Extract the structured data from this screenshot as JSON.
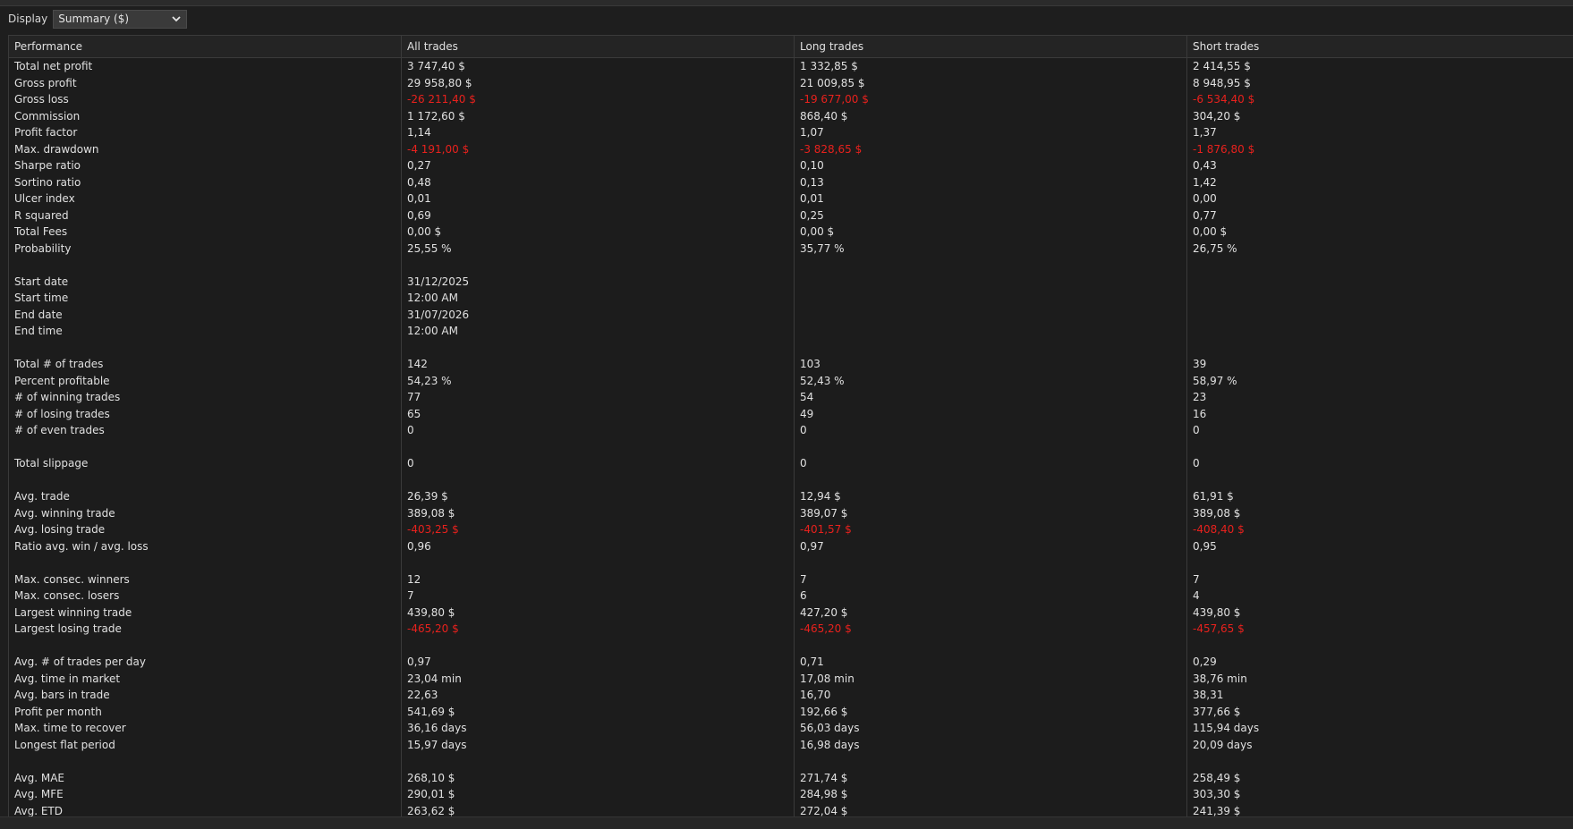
{
  "toolbar": {
    "display_label": "Display",
    "display_select_value": "Summary ($)"
  },
  "columns": [
    "Performance",
    "All trades",
    "Long trades",
    "Short trades"
  ],
  "colors": {
    "negative": "#e8211d",
    "text": "#e0e0e0",
    "background": "#1e1e1e"
  },
  "rows": [
    {
      "label": "Total net profit",
      "all": "3 747,40 $",
      "long": "1 332,85 $",
      "short": "2 414,55 $",
      "neg": false
    },
    {
      "label": "Gross profit",
      "all": "29 958,80 $",
      "long": "21 009,85 $",
      "short": "8 948,95 $",
      "neg": false
    },
    {
      "label": "Gross loss",
      "all": "-26 211,40 $",
      "long": "-19 677,00 $",
      "short": "-6 534,40 $",
      "neg": true
    },
    {
      "label": "Commission",
      "all": "1 172,60 $",
      "long": "868,40 $",
      "short": "304,20 $",
      "neg": false
    },
    {
      "label": "Profit factor",
      "all": "1,14",
      "long": "1,07",
      "short": "1,37",
      "neg": false
    },
    {
      "label": "Max. drawdown",
      "all": "-4 191,00 $",
      "long": "-3 828,65 $",
      "short": "-1 876,80 $",
      "neg": true
    },
    {
      "label": "Sharpe ratio",
      "all": "0,27",
      "long": "0,10",
      "short": "0,43",
      "neg": false
    },
    {
      "label": "Sortino ratio",
      "all": "0,48",
      "long": "0,13",
      "short": "1,42",
      "neg": false
    },
    {
      "label": "Ulcer index",
      "all": "0,01",
      "long": "0,01",
      "short": "0,00",
      "neg": false
    },
    {
      "label": "R squared",
      "all": "0,69",
      "long": "0,25",
      "short": "0,77",
      "neg": false
    },
    {
      "label": "Total Fees",
      "all": "0,00 $",
      "long": "0,00 $",
      "short": "0,00 $",
      "neg": false
    },
    {
      "label": "Probability",
      "all": "25,55 %",
      "long": "35,77 %",
      "short": "26,75 %",
      "neg": false
    },
    {
      "label": "",
      "all": "",
      "long": "",
      "short": "",
      "neg": false
    },
    {
      "label": "Start date",
      "all": "31/12/2025",
      "long": "",
      "short": "",
      "neg": false
    },
    {
      "label": "Start time",
      "all": "12:00 AM",
      "long": "",
      "short": "",
      "neg": false
    },
    {
      "label": "End date",
      "all": "31/07/2026",
      "long": "",
      "short": "",
      "neg": false
    },
    {
      "label": "End time",
      "all": "12:00 AM",
      "long": "",
      "short": "",
      "neg": false
    },
    {
      "label": "",
      "all": "",
      "long": "",
      "short": "",
      "neg": false
    },
    {
      "label": "Total # of trades",
      "all": "142",
      "long": "103",
      "short": "39",
      "neg": false
    },
    {
      "label": "Percent profitable",
      "all": "54,23 %",
      "long": "52,43 %",
      "short": "58,97 %",
      "neg": false
    },
    {
      "label": "# of winning trades",
      "all": "77",
      "long": "54",
      "short": "23",
      "neg": false
    },
    {
      "label": "# of losing trades",
      "all": "65",
      "long": "49",
      "short": "16",
      "neg": false
    },
    {
      "label": "# of even trades",
      "all": "0",
      "long": "0",
      "short": "0",
      "neg": false
    },
    {
      "label": "",
      "all": "",
      "long": "",
      "short": "",
      "neg": false
    },
    {
      "label": "Total slippage",
      "all": "0",
      "long": "0",
      "short": "0",
      "neg": false
    },
    {
      "label": "",
      "all": "",
      "long": "",
      "short": "",
      "neg": false
    },
    {
      "label": "Avg. trade",
      "all": "26,39 $",
      "long": "12,94 $",
      "short": "61,91 $",
      "neg": false
    },
    {
      "label": "Avg. winning trade",
      "all": "389,08 $",
      "long": "389,07 $",
      "short": "389,08 $",
      "neg": false
    },
    {
      "label": "Avg. losing trade",
      "all": "-403,25 $",
      "long": "-401,57 $",
      "short": "-408,40 $",
      "neg": true
    },
    {
      "label": "Ratio avg. win / avg. loss",
      "all": "0,96",
      "long": "0,97",
      "short": "0,95",
      "neg": false
    },
    {
      "label": "",
      "all": "",
      "long": "",
      "short": "",
      "neg": false
    },
    {
      "label": "Max. consec. winners",
      "all": "12",
      "long": "7",
      "short": "7",
      "neg": false
    },
    {
      "label": "Max. consec. losers",
      "all": "7",
      "long": "6",
      "short": "4",
      "neg": false
    },
    {
      "label": "Largest winning trade",
      "all": "439,80 $",
      "long": "427,20 $",
      "short": "439,80 $",
      "neg": false
    },
    {
      "label": "Largest losing trade",
      "all": "-465,20 $",
      "long": "-465,20 $",
      "short": "-457,65 $",
      "neg": true
    },
    {
      "label": "",
      "all": "",
      "long": "",
      "short": "",
      "neg": false
    },
    {
      "label": "Avg. # of trades per day",
      "all": "0,97",
      "long": "0,71",
      "short": "0,29",
      "neg": false
    },
    {
      "label": "Avg. time in market",
      "all": "23,04 min",
      "long": "17,08 min",
      "short": "38,76 min",
      "neg": false
    },
    {
      "label": "Avg. bars in trade",
      "all": "22,63",
      "long": "16,70",
      "short": "38,31",
      "neg": false
    },
    {
      "label": "Profit per month",
      "all": "541,69 $",
      "long": "192,66 $",
      "short": "377,66 $",
      "neg": false
    },
    {
      "label": "Max. time to recover",
      "all": "36,16 days",
      "long": "56,03 days",
      "short": "115,94 days",
      "neg": false
    },
    {
      "label": "Longest flat period",
      "all": "15,97 days",
      "long": "16,98 days",
      "short": "20,09 days",
      "neg": false
    },
    {
      "label": "",
      "all": "",
      "long": "",
      "short": "",
      "neg": false
    },
    {
      "label": "Avg. MAE",
      "all": "268,10 $",
      "long": "271,74 $",
      "short": "258,49 $",
      "neg": false
    },
    {
      "label": "Avg. MFE",
      "all": "290,01 $",
      "long": "284,98 $",
      "short": "303,30 $",
      "neg": false
    },
    {
      "label": "Avg. ETD",
      "all": "263,62 $",
      "long": "272,04 $",
      "short": "241,39 $",
      "neg": false
    }
  ]
}
